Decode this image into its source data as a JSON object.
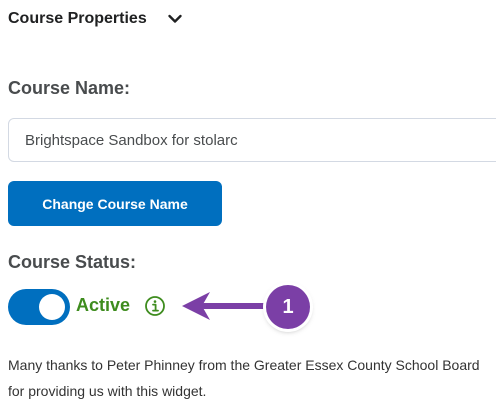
{
  "section": {
    "title": "Course Properties",
    "toggle_icon": "chevron-down-icon"
  },
  "course_name": {
    "label": "Course Name:",
    "value": "Brightspace Sandbox for stolarc",
    "placeholder": ""
  },
  "change_button": {
    "label": "Change Course Name"
  },
  "course_status": {
    "label": "Course Status:",
    "toggle_on": true,
    "state_text": "Active",
    "state_icon": "info-circle-icon"
  },
  "annotation": {
    "number": "1",
    "icon": "arrow-left-icon"
  },
  "footer": {
    "text": "Many thanks to Peter Phinney from the Greater Essex County School Board for providing us with this widget."
  },
  "colors": {
    "primary": "#006fbf",
    "active_text": "#3e8c1e",
    "annotation": "#7b3fa6"
  }
}
